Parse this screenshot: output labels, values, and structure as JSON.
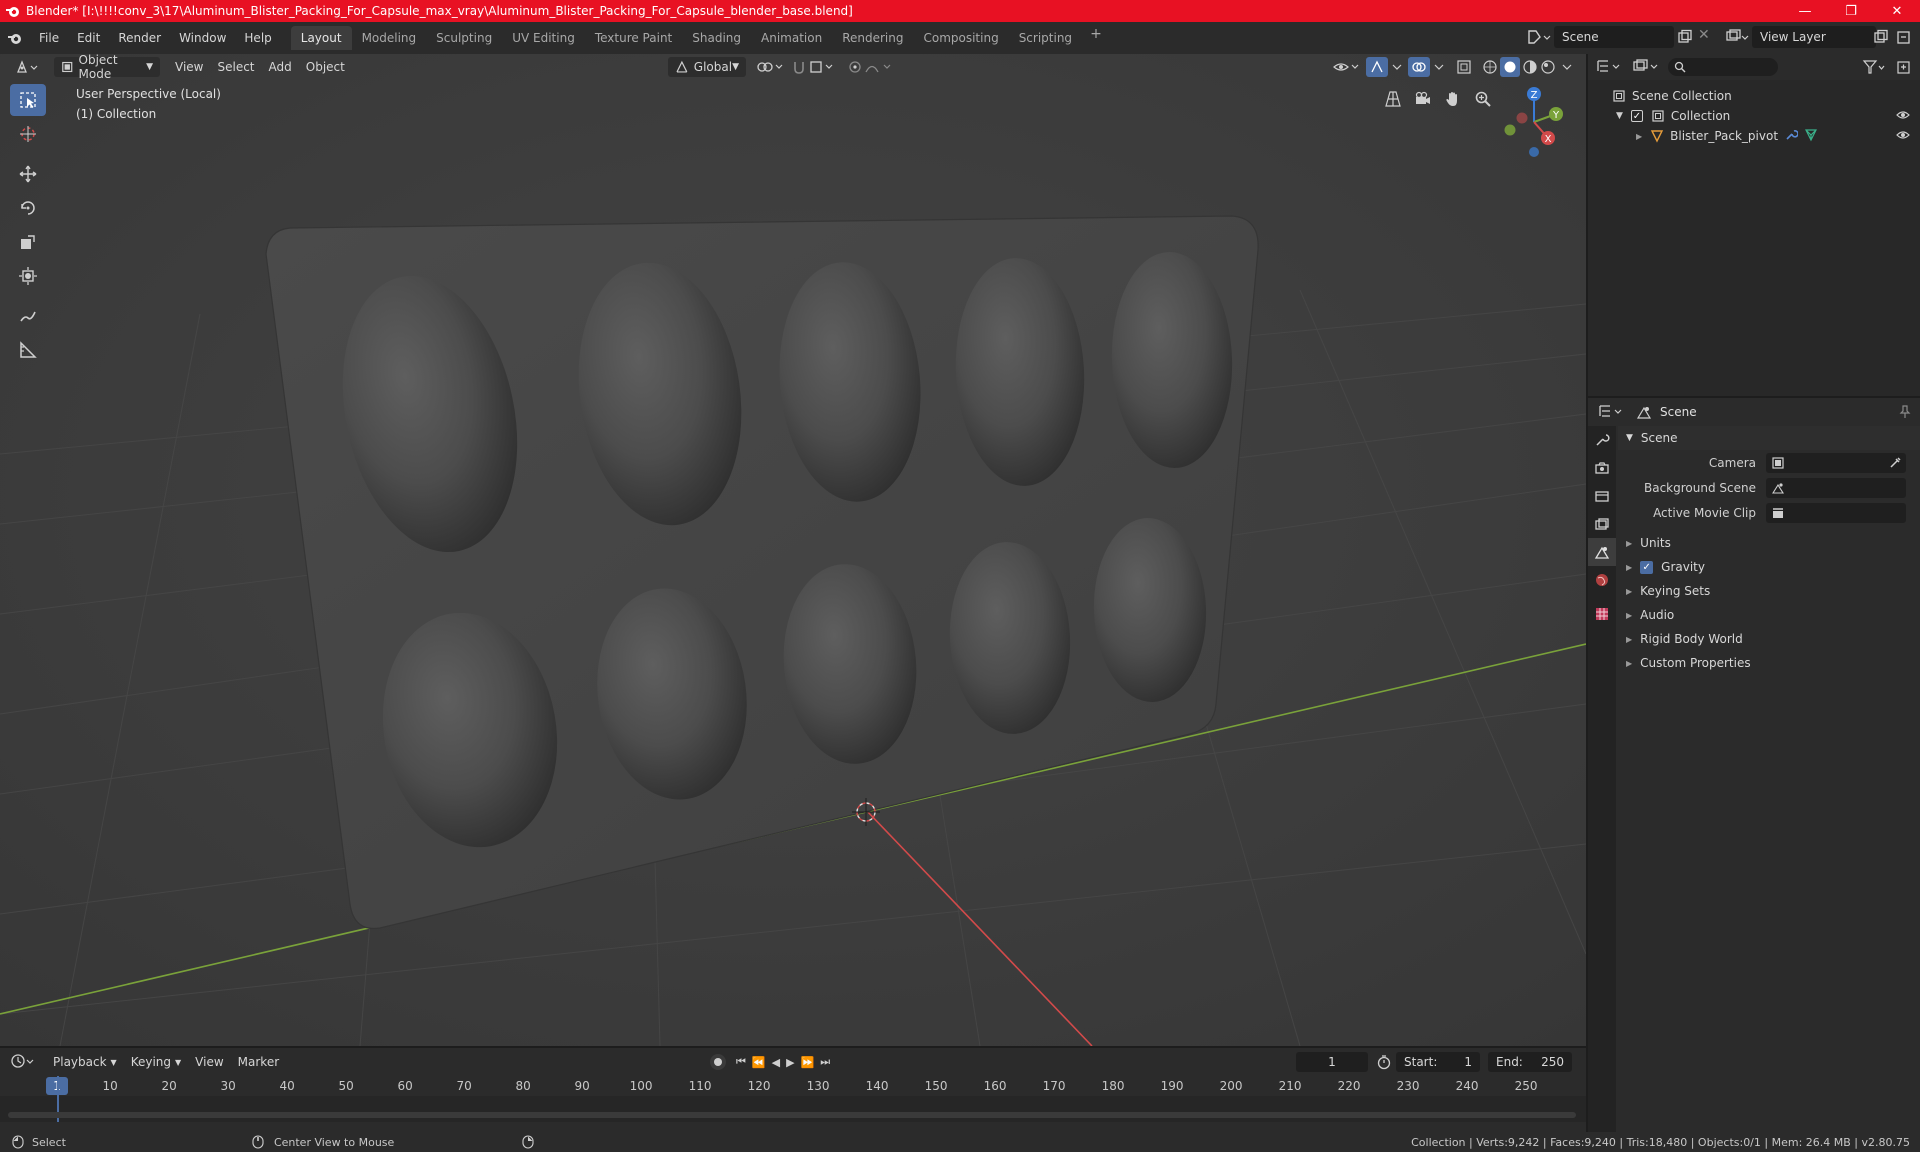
{
  "titlebar": {
    "title": "Blender* [I:\\!!!!conv_3\\17\\Aluminum_Blister_Packing_For_Capsule_max_vray\\Aluminum_Blister_Packing_For_Capsule_blender_base.blend]",
    "bg_color": "#e81123"
  },
  "menu": {
    "items": [
      "File",
      "Edit",
      "Render",
      "Window",
      "Help"
    ]
  },
  "workspaces": {
    "tabs": [
      "Layout",
      "Modeling",
      "Sculpting",
      "UV Editing",
      "Texture Paint",
      "Shading",
      "Animation",
      "Rendering",
      "Compositing",
      "Scripting"
    ],
    "active": "Layout",
    "add": "+"
  },
  "scene_selector": {
    "value": "Scene"
  },
  "view_layer_selector": {
    "value": "View Layer"
  },
  "viewport_header": {
    "mode": "Object Mode",
    "menus": [
      "View",
      "Select",
      "Add",
      "Object"
    ],
    "orientation": "Global"
  },
  "viewport": {
    "info_line1": "User Perspective (Local)",
    "info_line2": "(1) Collection",
    "gizmo": {
      "x": "X",
      "y": "Y",
      "z": "Z"
    },
    "colors": {
      "x_axis": "#d24a4a",
      "y_axis": "#7aa23a",
      "z_axis": "#3a7bd5",
      "accent": "#4b6da3"
    }
  },
  "outliner": {
    "search_placeholder": "",
    "rows": {
      "scene_collection": "Scene Collection",
      "collection": "Collection",
      "object": "Blister_Pack_pivot"
    }
  },
  "properties": {
    "header": "Scene",
    "panel_title": "Scene",
    "fields": {
      "camera": "Camera",
      "background_scene": "Background Scene",
      "active_movie_clip": "Active Movie Clip"
    },
    "subpanels": {
      "units": "Units",
      "gravity": "Gravity",
      "keying_sets": "Keying Sets",
      "audio": "Audio",
      "rigid_body_world": "Rigid Body World",
      "custom_properties": "Custom Properties"
    },
    "gravity_checked": true
  },
  "timeline": {
    "menus": [
      "Playback",
      "Keying",
      "View",
      "Marker"
    ],
    "current_frame": "1",
    "start_label": "Start:",
    "start_value": "1",
    "end_label": "End:",
    "end_value": "250",
    "ruler_current": "1",
    "ruler_ticks": [
      "10",
      "20",
      "30",
      "40",
      "50",
      "60",
      "70",
      "80",
      "90",
      "100",
      "110",
      "120",
      "130",
      "140",
      "150",
      "160",
      "170",
      "180",
      "190",
      "200",
      "210",
      "220",
      "230",
      "240",
      "250"
    ]
  },
  "statusbar": {
    "select": "Select",
    "center_view": "Center View to Mouse",
    "stats": "Collection | Verts:9,242 | Faces:9,240 | Tris:18,480 | Objects:0/1 | Mem: 26.4 MB | v2.80.75"
  }
}
